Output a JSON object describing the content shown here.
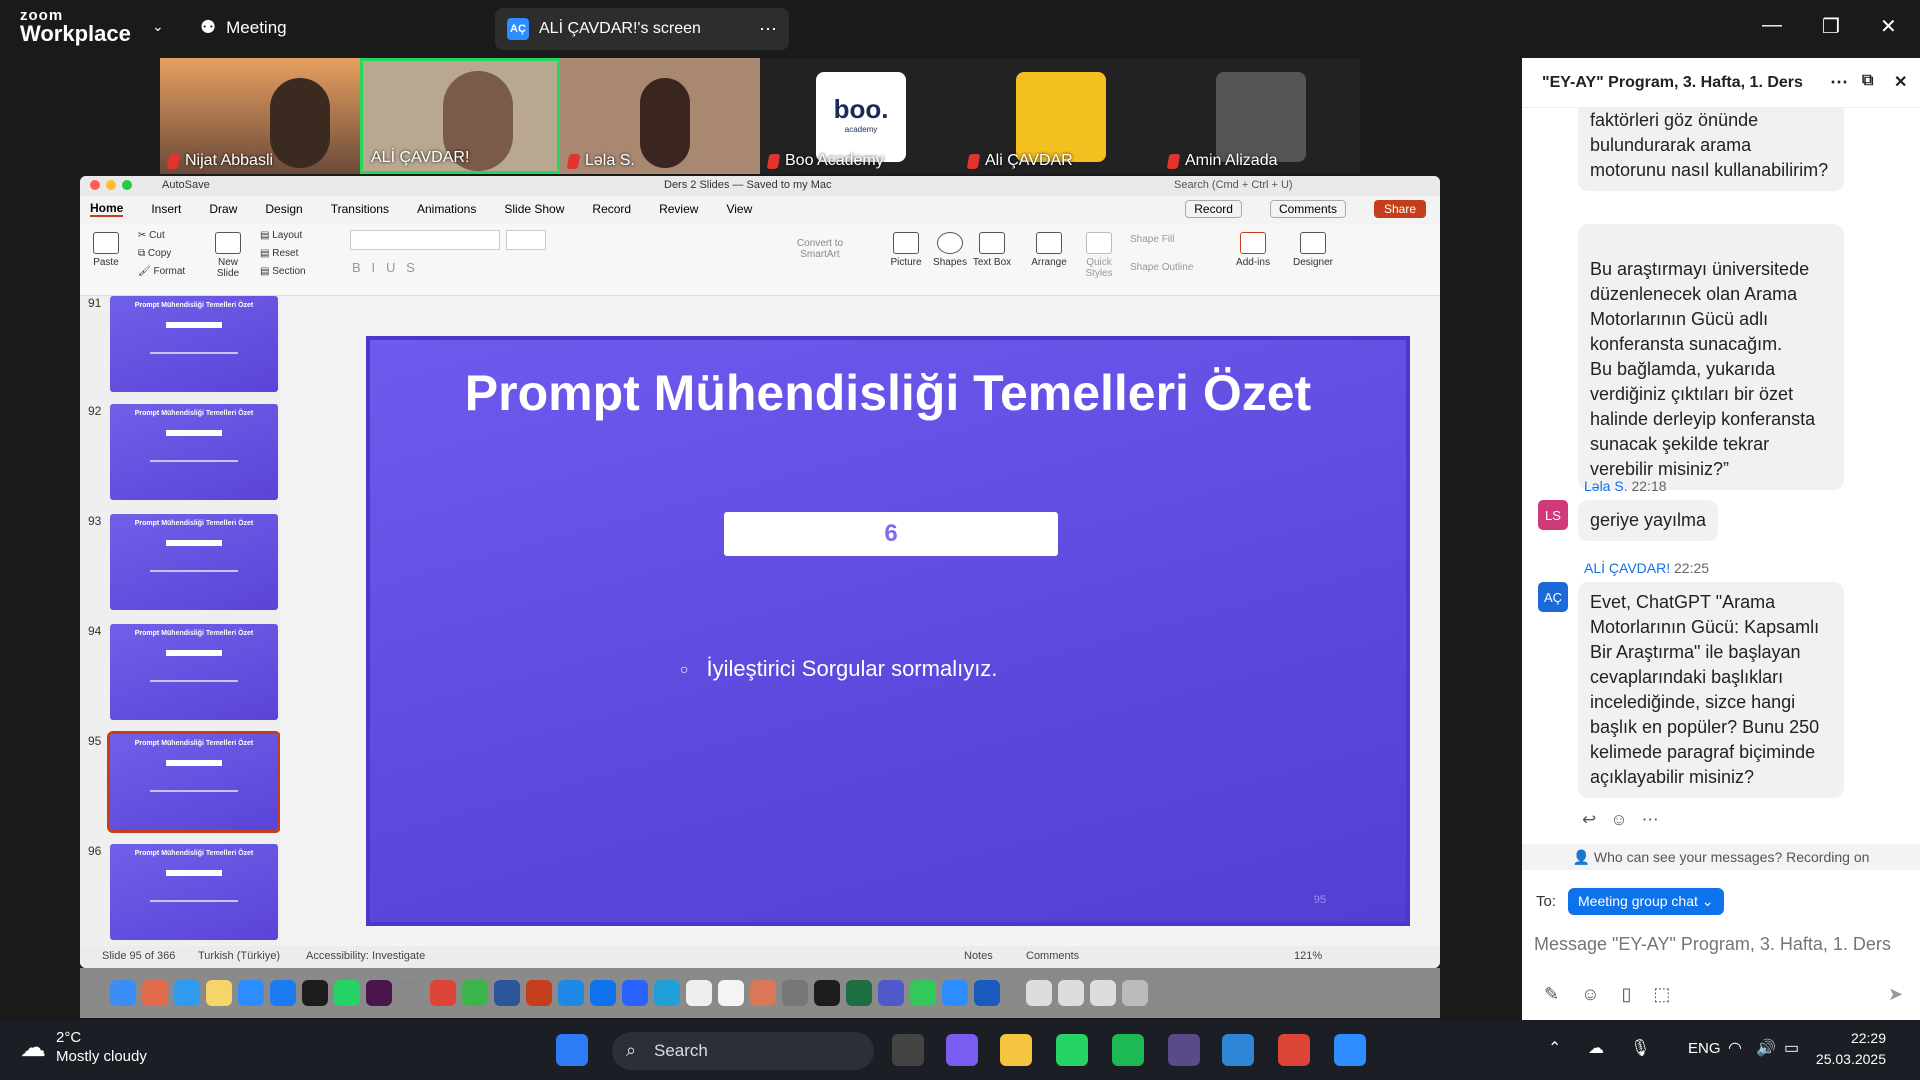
{
  "zoom": {
    "logo_top": "zoom",
    "logo_bottom": "Workplace",
    "meeting_label": "Meeting",
    "share_initials": "AÇ",
    "share_label": "ALİ ÇAVDAR!'s screen"
  },
  "participants": [
    {
      "name": "Nijat Abbasli"
    },
    {
      "name": "ALİ ÇAVDAR!"
    },
    {
      "name": "Ləla S."
    },
    {
      "name": "Boo Academy",
      "logo": "boo.",
      "logo_sub": "academy"
    },
    {
      "name": "Ali ÇAVDAR"
    },
    {
      "name": "Amin Alizada"
    }
  ],
  "ppt": {
    "autosave": "AutoSave",
    "doc_title": "Ders 2 Slides — Saved to my Mac",
    "search_placeholder": "Search (Cmd + Ctrl + U)",
    "tabs": [
      "Home",
      "Insert",
      "Draw",
      "Design",
      "Transitions",
      "Animations",
      "Slide Show",
      "Record",
      "Review",
      "View"
    ],
    "record_btn": "Record",
    "comments_btn": "Comments",
    "share_btn": "Share",
    "ribbon": {
      "paste": "Paste",
      "cut": "Cut",
      "copy": "Copy",
      "format": "Format",
      "new_slide": "New Slide",
      "layout": "Layout",
      "reset": "Reset",
      "section": "Section",
      "convert": "Convert to SmartArt",
      "picture": "Picture",
      "shapes": "Shapes",
      "textbox": "Text Box",
      "arrange": "Arrange",
      "quick_styles": "Quick Styles",
      "shape_fill": "Shape Fill",
      "shape_outline": "Shape Outline",
      "addins": "Add-ins",
      "designer": "Designer"
    },
    "thumbnails": [
      {
        "num": "91",
        "title": "Prompt Mühendisliği Temelleri Özet"
      },
      {
        "num": "92",
        "title": "Prompt Mühendisliği Temelleri Özet"
      },
      {
        "num": "93",
        "title": "Prompt Mühendisliği Temelleri Özet"
      },
      {
        "num": "94",
        "title": "Prompt Mühendisliği Temelleri Özet"
      },
      {
        "num": "95",
        "title": "Prompt Mühendisliği Temelleri Özet"
      },
      {
        "num": "96",
        "title": "Prompt Mühendisliği Temelleri Özet"
      }
    ],
    "slide": {
      "title": "Prompt Mühendisliği Temelleri Özet",
      "box_number": "6",
      "bullet": "İyileştirici Sorgular sormalıyız.",
      "page_number": "95"
    },
    "status": {
      "slide_count": "Slide 95 of 366",
      "language": "Turkish (Türkiye)",
      "accessibility": "Accessibility: Investigate",
      "notes": "Notes",
      "comments": "Comments",
      "zoom": "121%"
    }
  },
  "chat": {
    "title": "\"EY-AY\" Program, 3. Hafta, 1. Ders",
    "messages": [
      {
        "text": "faktörleri göz önünde bulundurarak arama motorunu nasıl kullanabilirim?"
      },
      {
        "text": "Bu araştırmayı üniversitede düzenlenecek olan Arama Motorlarının Gücü adlı konferansta sunacağım.\nBu bağlamda, yukarıda verdiğiniz çıktıları bir özet halinde derleyip konferansta sunacak şekilde tekrar verebilir misiniz?”"
      },
      {
        "sender": "Ləla S.",
        "time": "22:18",
        "initials": "LS",
        "text": "geriye yayılma"
      },
      {
        "sender": "ALİ ÇAVDAR!",
        "time": "22:25",
        "initials": "AÇ",
        "text": "Evet, ChatGPT \"Arama Motorlarının Gücü: Kapsamlı Bir Araştırma\" ile başlayan cevaplarındaki başlıkları incelediğinde, sizce hangi başlık en popüler? Bunu 250 kelimede paragraf biçiminde açıklayabilir misiniz?"
      }
    ],
    "who_can_see": "Who can see your messages? Recording on",
    "to_label": "To:",
    "to_value": "Meeting group chat",
    "input_placeholder": "Message \"EY-AY\" Program, 3. Hafta, 1. Ders"
  },
  "taskbar": {
    "temp": "2°C",
    "weather": "Mostly cloudy",
    "search": "Search",
    "lang": "ENG",
    "time": "22:29",
    "date": "25.03.2025"
  }
}
